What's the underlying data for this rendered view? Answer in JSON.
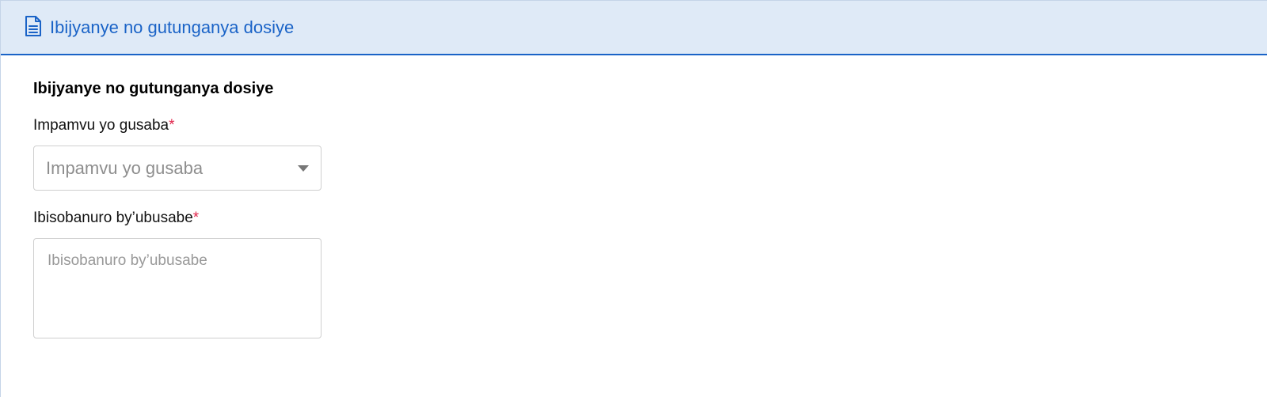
{
  "header": {
    "icon": "document-icon",
    "title": "Ibijyanye no gutunganya dosiye",
    "accent_color": "#1a63c7",
    "background_color": "#dfeaf7"
  },
  "section": {
    "title": "Ibijyanye no gutunganya dosiye"
  },
  "fields": {
    "reason": {
      "label": "Impamvu yo gusaba",
      "required_marker": "*",
      "placeholder": "Impamvu yo gusaba",
      "value": ""
    },
    "description": {
      "label": "Ibisobanuro by’ubusabe",
      "required_marker": "*",
      "placeholder": "Ibisobanuro by’ubusabe",
      "value": ""
    }
  },
  "colors": {
    "required": "#e0244a",
    "placeholder": "#8e8e8e"
  }
}
